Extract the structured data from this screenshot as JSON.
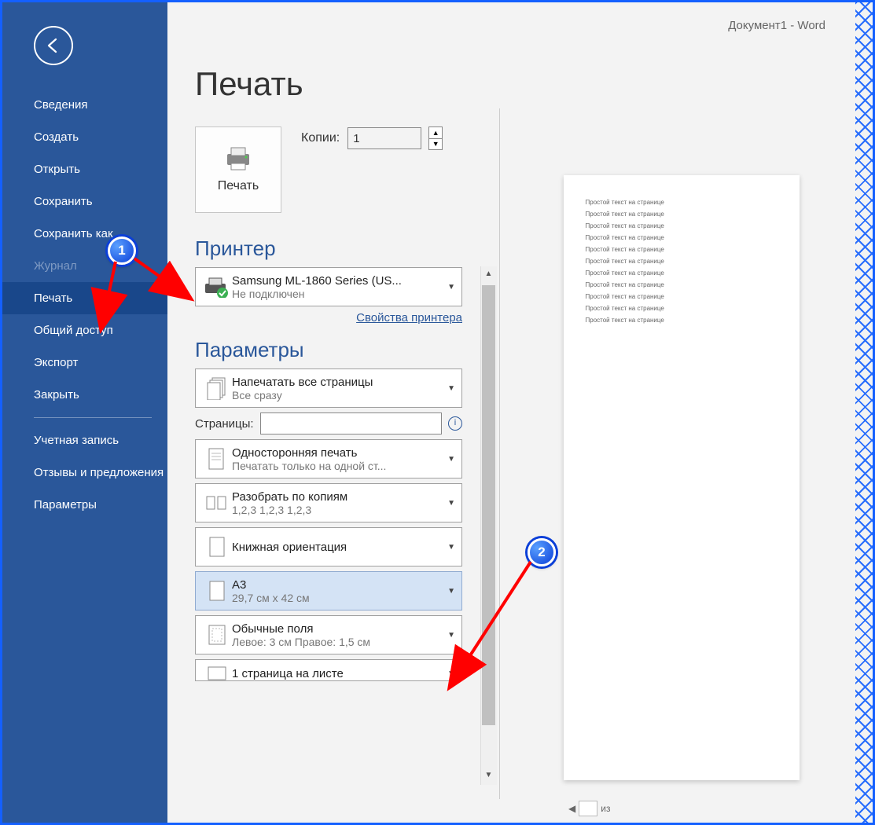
{
  "titlebar": "Документ1  -  Word",
  "sidebar": {
    "items": [
      {
        "label": "Сведения",
        "key": "info"
      },
      {
        "label": "Создать",
        "key": "new"
      },
      {
        "label": "Открыть",
        "key": "open"
      },
      {
        "label": "Сохранить",
        "key": "save"
      },
      {
        "label": "Сохранить как",
        "key": "saveas"
      },
      {
        "label": "Журнал",
        "key": "history"
      },
      {
        "label": "Печать",
        "key": "print"
      },
      {
        "label": "Общий доступ",
        "key": "share"
      },
      {
        "label": "Экспорт",
        "key": "export"
      },
      {
        "label": "Закрыть",
        "key": "close"
      }
    ],
    "footer": [
      {
        "label": "Учетная запись",
        "key": "account"
      },
      {
        "label": "Отзывы и предложения",
        "key": "feedback"
      },
      {
        "label": "Параметры",
        "key": "options"
      }
    ]
  },
  "page": {
    "title": "Печать",
    "print_button": "Печать",
    "copies_label": "Копии:",
    "copies_value": "1",
    "printer_head": "Принтер",
    "printer_name": "Samsung ML-1860 Series (US...",
    "printer_status": "Не подключен",
    "printer_props_link": "Свойства принтера",
    "settings_head": "Параметры",
    "pages_label": "Страницы:",
    "pages_value": "",
    "combos": {
      "scope": {
        "line1": "Напечатать все страницы",
        "line2": "Все сразу"
      },
      "sides": {
        "line1": "Односторонняя печать",
        "line2": "Печатать только на одной ст..."
      },
      "collate": {
        "line1": "Разобрать по копиям",
        "line2": "1,2,3    1,2,3    1,2,3"
      },
      "orient": {
        "line1": "Книжная ориентация",
        "line2": ""
      },
      "paper": {
        "line1": "A3",
        "line2": "29,7 см x 42 см"
      },
      "margins": {
        "line1": "Обычные поля",
        "line2": "Левое:  3 см    Правое:  1,5 см"
      },
      "pps": {
        "line1": "1 страница на листе",
        "line2": ""
      }
    }
  },
  "preview": {
    "line": "Простой текст на странице",
    "line_count": 11,
    "footer_text": "из"
  },
  "annotations": {
    "callout1": "1",
    "callout2": "2"
  }
}
